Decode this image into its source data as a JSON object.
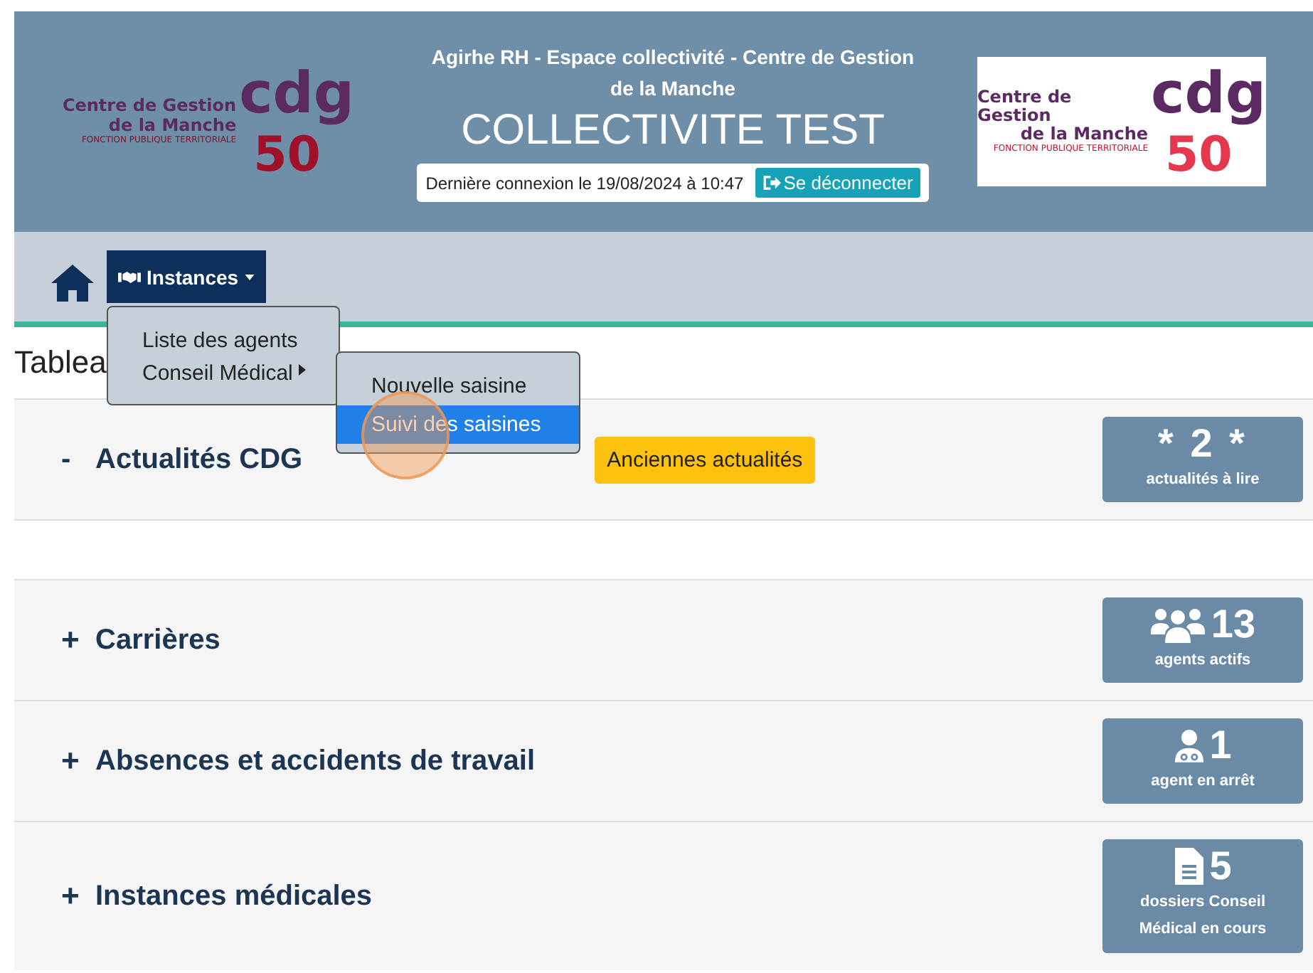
{
  "logos": [
    {
      "mark": "cdg",
      "number": "50",
      "name_1": "Centre de Gestion",
      "name_2": "de la Manche",
      "tagline": "FONCTION PUBLIQUE TERRITORIALE"
    },
    {
      "mark": "cdg",
      "number": "50",
      "name_1": "Centre de Gestion",
      "name_2": "de la Manche",
      "tagline": "FONCTION PUBLIQUE TERRITORIALE"
    }
  ],
  "header": {
    "title": "Agirhe RH - Espace collectivité - Centre de Gestion de la Manche",
    "collectivity": "COLLECTIVITE TEST",
    "last_login": "Dernière connexion le 19/08/2024 à 10:47",
    "logout": "Se déconnecter"
  },
  "nav": {
    "menu": {
      "label": "Instances",
      "items": [
        {
          "label": "Liste des agents",
          "has_submenu": false
        },
        {
          "label": "Conseil Médical",
          "has_submenu": true
        }
      ],
      "submenu": [
        {
          "label": "Nouvelle saisine",
          "selected": false
        },
        {
          "label": "Suivi des saisines",
          "selected": true
        }
      ]
    }
  },
  "page_title": "Tablea",
  "sections": [
    {
      "sign": "-",
      "title": "Actualités CDG",
      "expanded": true,
      "button": "Anciennes actualités",
      "stat": {
        "kind": "plain",
        "value": "* 2 *",
        "label": "actualités à lire"
      }
    },
    {
      "sign": "+",
      "title": "Carrières",
      "expanded": false,
      "stat": {
        "kind": "users",
        "value": "13",
        "label": "agents actifs"
      }
    },
    {
      "sign": "+",
      "title": "Absences et accidents de travail",
      "expanded": false,
      "stat": {
        "kind": "doctor",
        "value": "1",
        "label": "agent en arrêt"
      }
    },
    {
      "sign": "+",
      "title": "Instances médicales",
      "expanded": false,
      "stat": {
        "kind": "file",
        "value": "5",
        "label": "dossiers Conseil Médical en cours"
      }
    }
  ]
}
